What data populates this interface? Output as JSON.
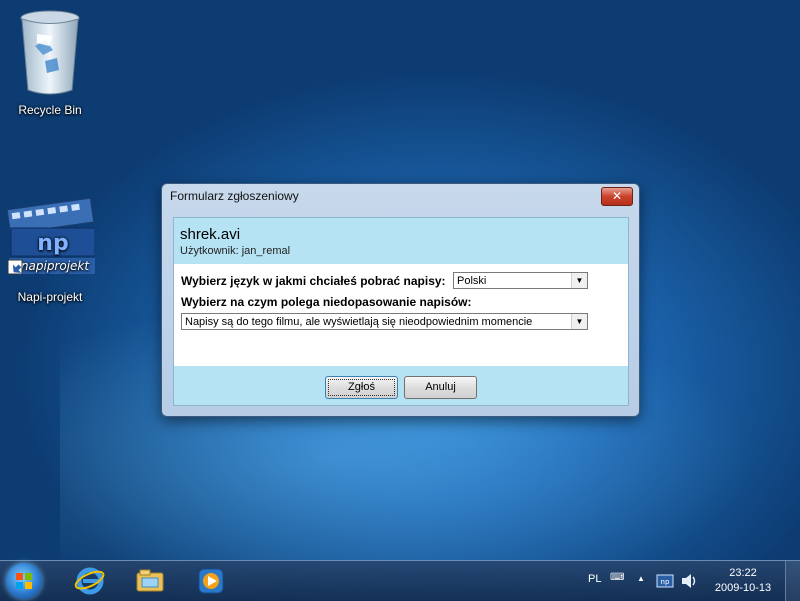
{
  "desktop": {
    "icons": [
      {
        "label": "Recycle Bin",
        "icon": "recycle-bin-icon"
      },
      {
        "label": "Napi-projekt",
        "icon": "napiprojekt-icon",
        "logo_text": "napiprojekt"
      }
    ]
  },
  "dialog": {
    "title": "Formularz zgłoszeniowy",
    "close_label": "✕",
    "filename": "shrek.avi",
    "user_line": "Użytkownik: jan_remal",
    "language_prompt": "Wybierz język w jakmi chciałeś pobrać napisy:",
    "language_value": "Polski",
    "mismatch_prompt": "Wybierz na czym polega niedopasowanie napisów:",
    "mismatch_value": "Napisy są do tego filmu, ale wyświetlają się nieodpowiednim momencie",
    "submit_label": "Zgłoś",
    "cancel_label": "Anuluj"
  },
  "taskbar": {
    "pinned": [
      "internet-explorer-icon",
      "windows-explorer-icon",
      "media-player-icon"
    ],
    "language": "PL",
    "time": "23:22",
    "date": "2009-10-13"
  },
  "colors": {
    "dialog_accent": "#b5e3f4",
    "close_button": "#c9422c"
  }
}
